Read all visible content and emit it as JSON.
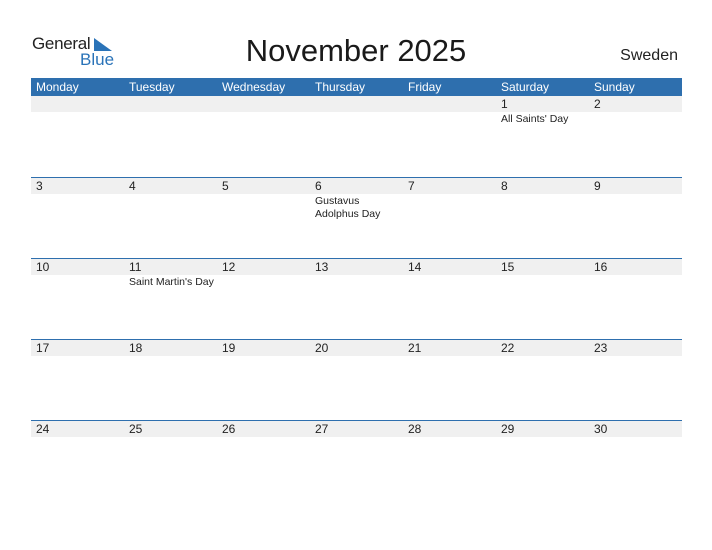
{
  "logo": {
    "line1": "General",
    "line2": "Blue"
  },
  "title": "November 2025",
  "country": "Sweden",
  "colors": {
    "header_bg": "#2e6fae",
    "accent": "#2a73b8",
    "day_strip": "#f0f0f0"
  },
  "weekdays": [
    "Monday",
    "Tuesday",
    "Wednesday",
    "Thursday",
    "Friday",
    "Saturday",
    "Sunday"
  ],
  "weeks": [
    {
      "days": [
        {
          "num": "",
          "holiday": ""
        },
        {
          "num": "",
          "holiday": ""
        },
        {
          "num": "",
          "holiday": ""
        },
        {
          "num": "",
          "holiday": ""
        },
        {
          "num": "",
          "holiday": ""
        },
        {
          "num": "1",
          "holiday": "All Saints' Day"
        },
        {
          "num": "2",
          "holiday": ""
        }
      ]
    },
    {
      "days": [
        {
          "num": "3",
          "holiday": ""
        },
        {
          "num": "4",
          "holiday": ""
        },
        {
          "num": "5",
          "holiday": ""
        },
        {
          "num": "6",
          "holiday": "Gustavus Adolphus Day"
        },
        {
          "num": "7",
          "holiday": ""
        },
        {
          "num": "8",
          "holiday": ""
        },
        {
          "num": "9",
          "holiday": ""
        }
      ]
    },
    {
      "days": [
        {
          "num": "10",
          "holiday": ""
        },
        {
          "num": "11",
          "holiday": "Saint Martin's Day"
        },
        {
          "num": "12",
          "holiday": ""
        },
        {
          "num": "13",
          "holiday": ""
        },
        {
          "num": "14",
          "holiday": ""
        },
        {
          "num": "15",
          "holiday": ""
        },
        {
          "num": "16",
          "holiday": ""
        }
      ]
    },
    {
      "days": [
        {
          "num": "17",
          "holiday": ""
        },
        {
          "num": "18",
          "holiday": ""
        },
        {
          "num": "19",
          "holiday": ""
        },
        {
          "num": "20",
          "holiday": ""
        },
        {
          "num": "21",
          "holiday": ""
        },
        {
          "num": "22",
          "holiday": ""
        },
        {
          "num": "23",
          "holiday": ""
        }
      ]
    },
    {
      "days": [
        {
          "num": "24",
          "holiday": ""
        },
        {
          "num": "25",
          "holiday": ""
        },
        {
          "num": "26",
          "holiday": ""
        },
        {
          "num": "27",
          "holiday": ""
        },
        {
          "num": "28",
          "holiday": ""
        },
        {
          "num": "29",
          "holiday": ""
        },
        {
          "num": "30",
          "holiday": ""
        }
      ]
    }
  ]
}
